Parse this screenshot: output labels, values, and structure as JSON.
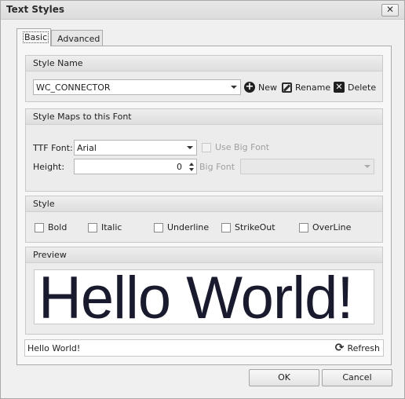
{
  "window": {
    "title": "Text Styles",
    "close_glyph": "✕"
  },
  "tabs": [
    {
      "label": "Basic",
      "active": true
    },
    {
      "label": "Advanced",
      "active": false
    }
  ],
  "style_name": {
    "heading": "Style Name",
    "selected": "WC_CONNECTOR",
    "buttons": {
      "new": "New",
      "rename": "Rename",
      "delete": "Delete"
    },
    "icons": {
      "new": "plus-circle-icon",
      "rename": "rename-icon",
      "delete": "delete-x-icon"
    }
  },
  "font_map": {
    "heading": "Style Maps to this Font",
    "ttf_label": "TTF Font:",
    "ttf_value": "Arial",
    "use_big_font_label": "Use Big Font",
    "use_big_font_checked": false,
    "height_label": "Height:",
    "height_value": "0",
    "big_font_label": "Big Font",
    "big_font_value": ""
  },
  "style": {
    "heading": "Style",
    "options": [
      {
        "label": "Bold",
        "checked": false
      },
      {
        "label": "Italic",
        "checked": false
      },
      {
        "label": "Underline",
        "checked": false
      },
      {
        "label": "StrikeOut",
        "checked": false
      },
      {
        "label": "OverLine",
        "checked": false
      }
    ]
  },
  "preview": {
    "heading": "Preview",
    "text": "Hello World!"
  },
  "sample_text": {
    "value": "Hello World!",
    "refresh_label": "Refresh",
    "refresh_icon": "refresh-icon"
  },
  "footer": {
    "ok": "OK",
    "cancel": "Cancel"
  }
}
